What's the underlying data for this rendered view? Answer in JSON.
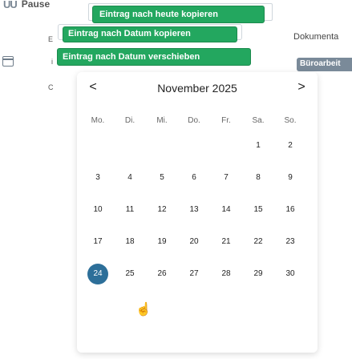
{
  "header": {
    "prefix_icon": "UU",
    "title": "Pause"
  },
  "background_left": {
    "letters": [
      "E",
      "i",
      "C"
    ]
  },
  "right_panel": {
    "label": "Dokumenta",
    "badge": "Büroarbeit"
  },
  "context_menu": {
    "items": [
      "Eintrag nach heute kopieren",
      "Eintrag nach Datum kopieren",
      "Eintrag nach Datum verschieben"
    ]
  },
  "calendar": {
    "prev": "<",
    "next": ">",
    "month_label": "November  2025",
    "weekdays": [
      "Mo.",
      "Di.",
      "Mi.",
      "Do.",
      "Fr.",
      "Sa.",
      "So."
    ],
    "weeks": [
      [
        "",
        "",
        "",
        "",
        "",
        "1",
        "2"
      ],
      [
        "3",
        "4",
        "5",
        "6",
        "7",
        "8",
        "9"
      ],
      [
        "10",
        "11",
        "12",
        "13",
        "14",
        "15",
        "16"
      ],
      [
        "17",
        "18",
        "19",
        "20",
        "21",
        "22",
        "23"
      ],
      [
        "24",
        "25",
        "26",
        "27",
        "28",
        "29",
        "30"
      ]
    ],
    "selected_day": "24"
  },
  "colors": {
    "menu_green": "#23a75f",
    "selected_day": "#2d6f99",
    "badge_gray": "#7a8a99"
  }
}
